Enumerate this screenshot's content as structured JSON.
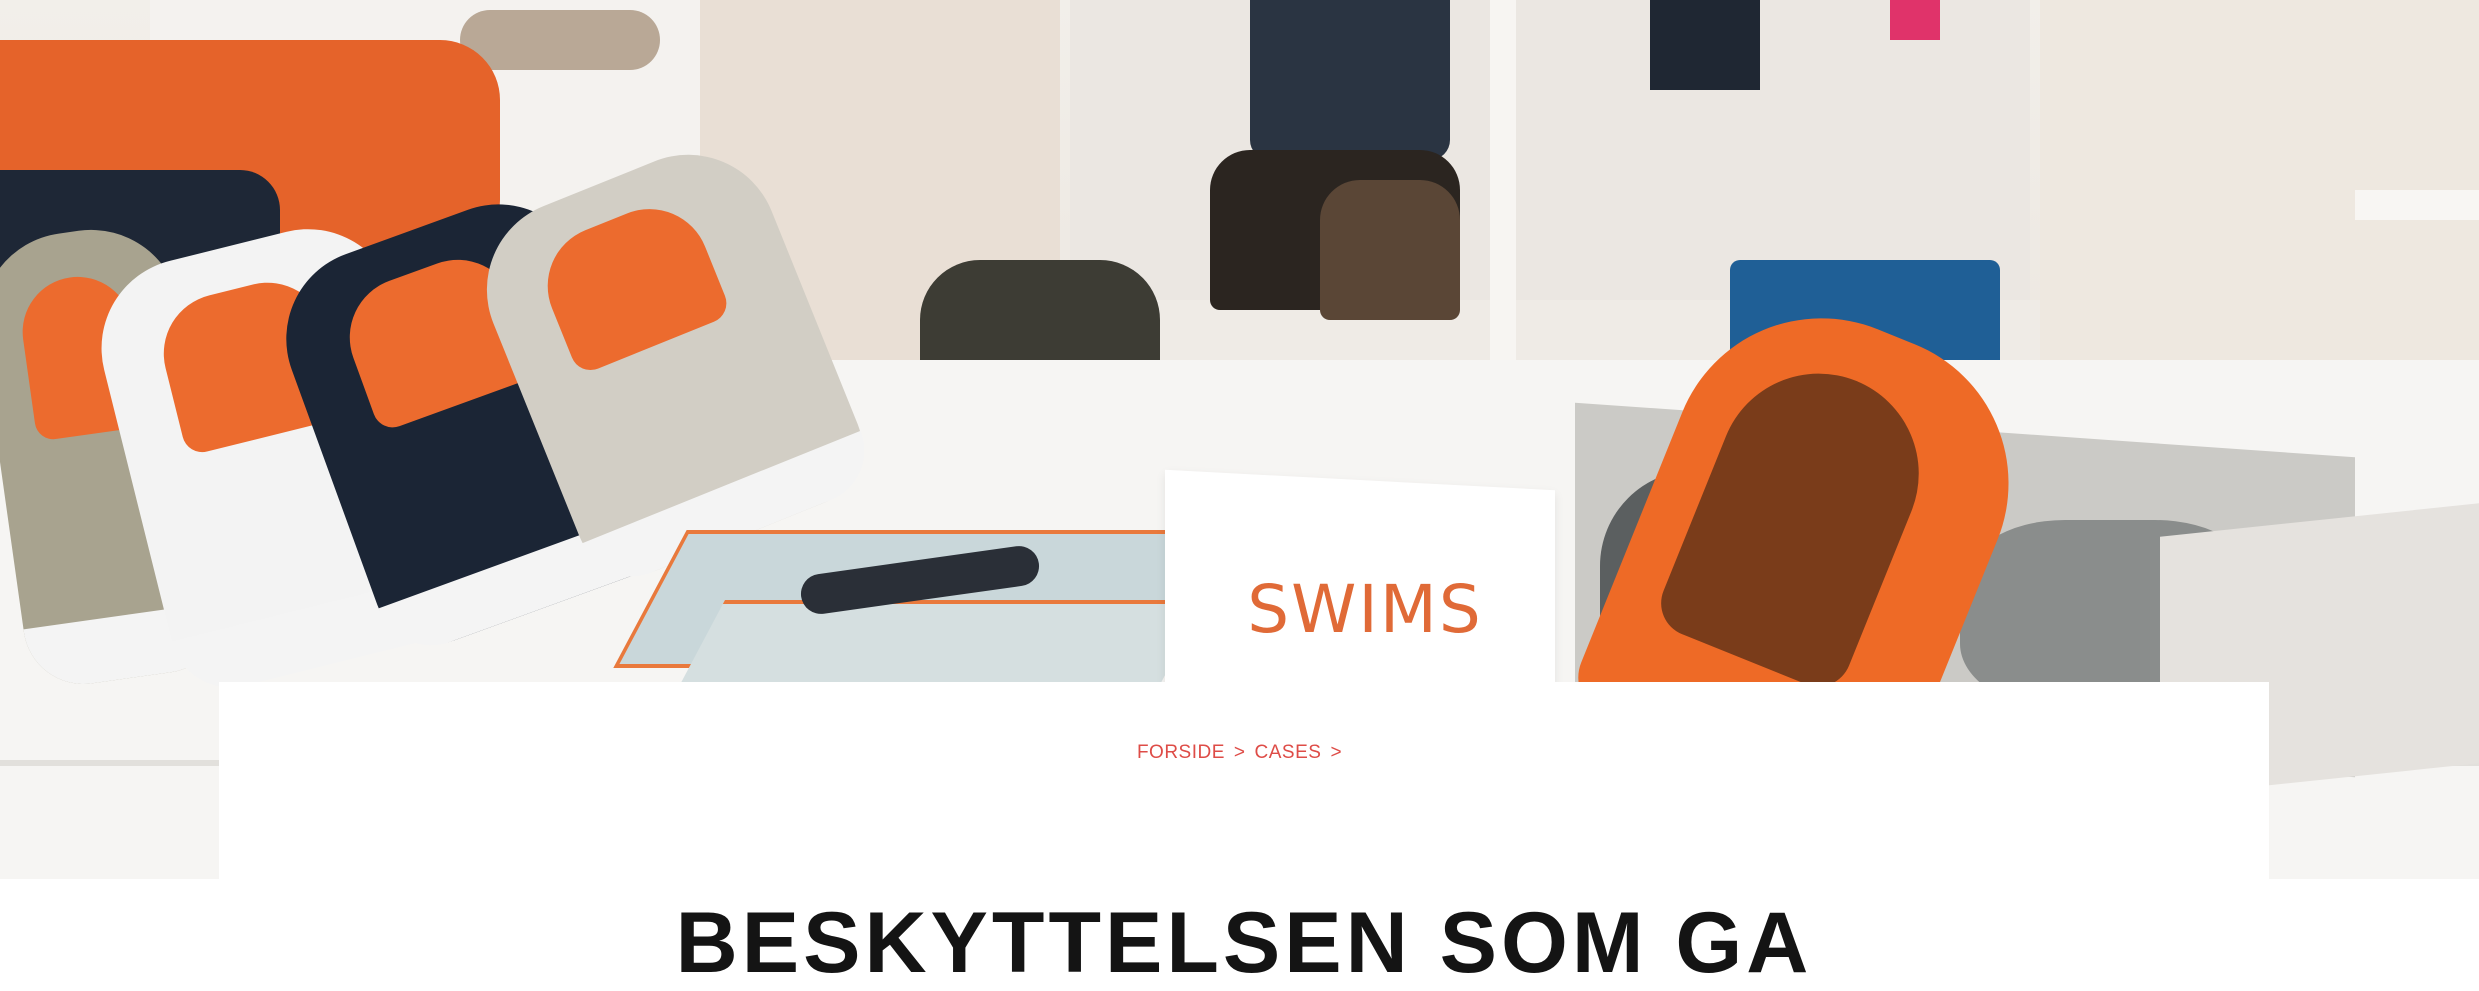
{
  "hero": {
    "image_alt": "",
    "logo_text": "SWIMS"
  },
  "breadcrumb": {
    "items": [
      "FORSIDE",
      "CASES"
    ],
    "separator": ">"
  },
  "headline": "BESKYTTELSEN SOM GA",
  "colors": {
    "accent": "#de4c47",
    "headline": "#141414",
    "brand_orange": "#ee6a26"
  }
}
